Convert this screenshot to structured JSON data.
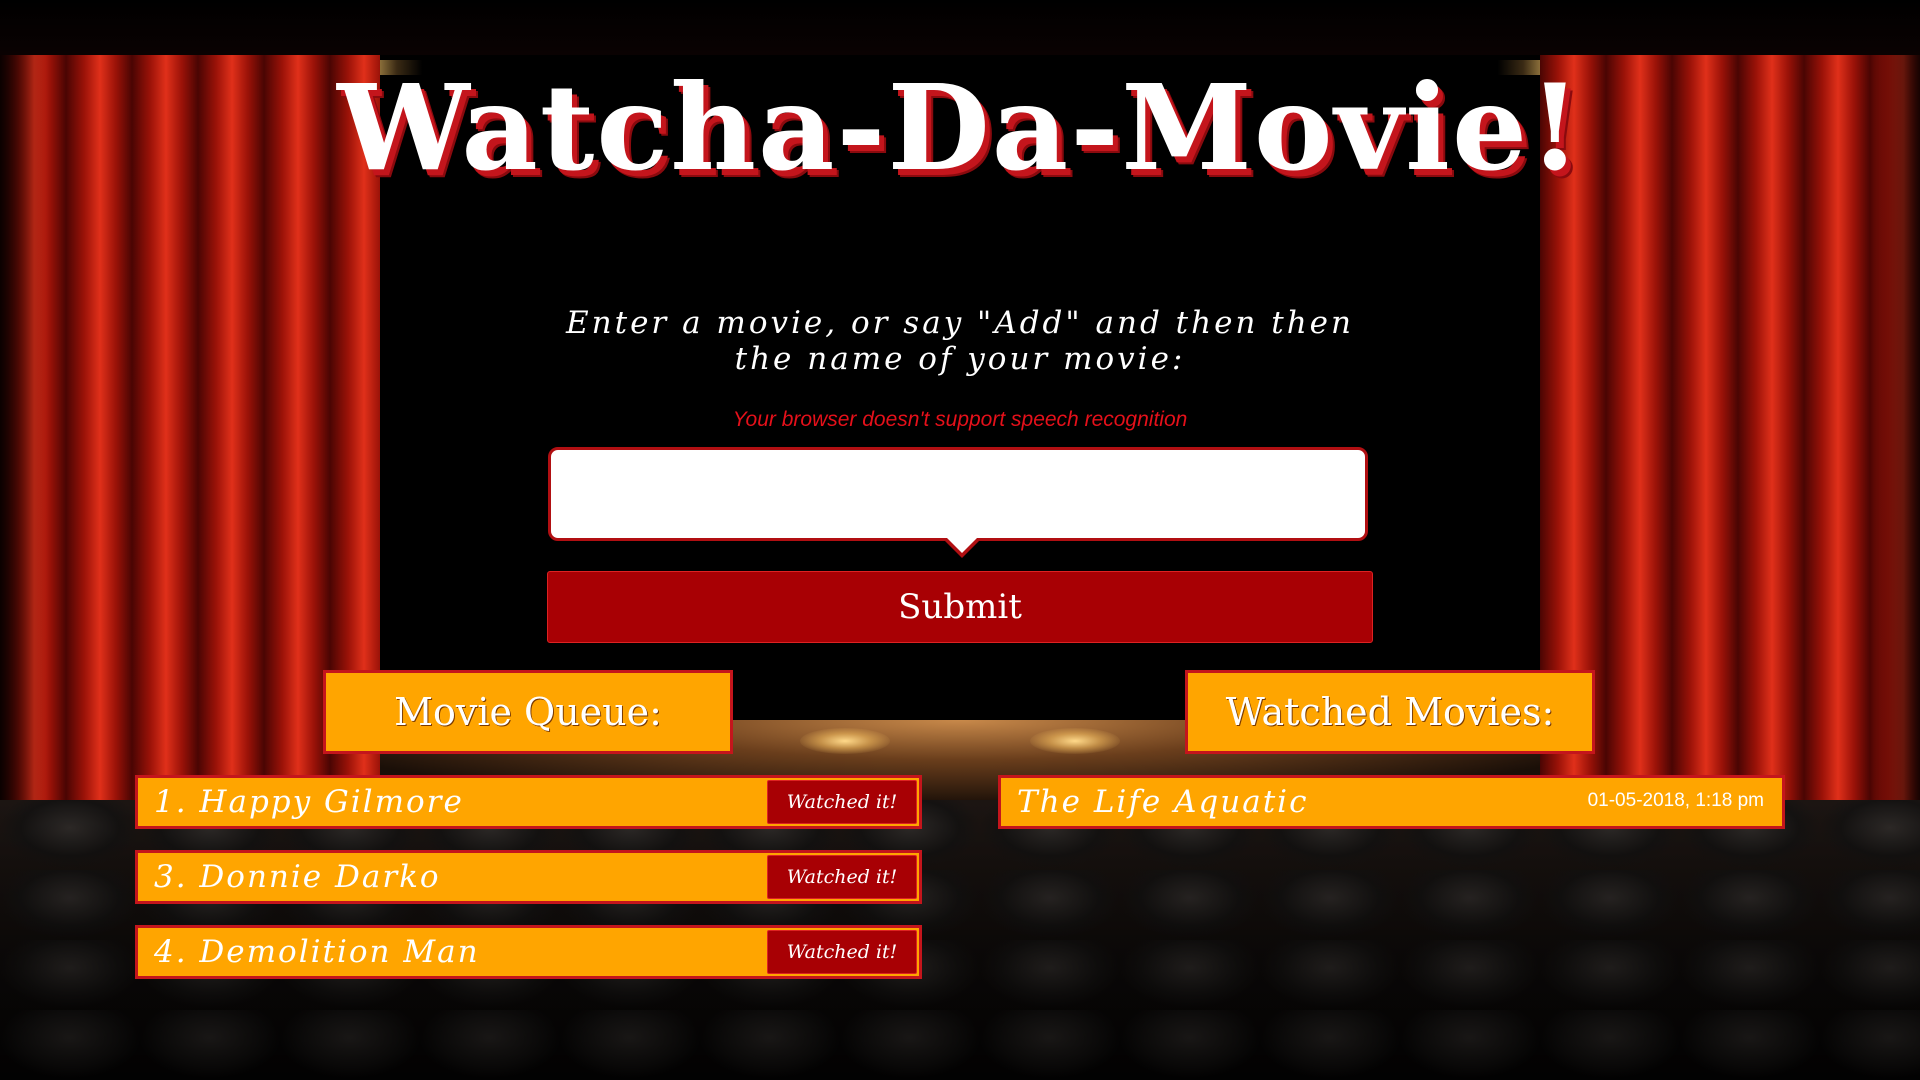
{
  "title": "Watcha-Da-Movie!",
  "prompt": {
    "line1": "Enter a movie, or say \"Add\" and then then",
    "line2": "the name of your movie:"
  },
  "error_message": "Your browser doesn't support speech recognition",
  "movie_input": {
    "value": "",
    "placeholder": ""
  },
  "submit_label": "Submit",
  "queue": {
    "heading": "Movie Queue:",
    "items": [
      {
        "label": "1. Happy Gilmore",
        "button": "Watched it!"
      },
      {
        "label": "3. Donnie Darko",
        "button": "Watched it!"
      },
      {
        "label": "4. Demolition Man",
        "button": "Watched it!"
      }
    ]
  },
  "watched": {
    "heading": "Watched Movies:",
    "items": [
      {
        "label": "The Life Aquatic",
        "date": "01-05-2018, 1:18 pm"
      }
    ]
  },
  "colors": {
    "accent_orange": "#ffa500",
    "button_red": "#a80004",
    "border_red": "#c4151c",
    "error_red": "#e5101a"
  }
}
